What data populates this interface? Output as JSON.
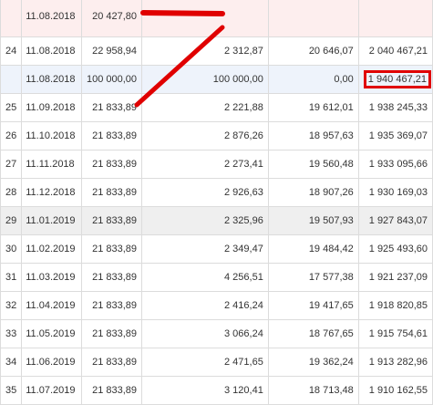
{
  "schedule": {
    "rows": [
      {
        "num": "",
        "date": "11.08.2018",
        "payment": "20 427,80",
        "principal": "",
        "interest": "",
        "balance": "",
        "style": "pink"
      },
      {
        "num": "24",
        "date": "11.08.2018",
        "payment": "22 958,94",
        "principal": "2 312,87",
        "interest": "20 646,07",
        "balance": "2 040 467,21",
        "style": ""
      },
      {
        "num": "",
        "date": "11.08.2018",
        "payment": "100 000,00",
        "principal": "100 000,00",
        "interest": "0,00",
        "balance": "1 940 467,21",
        "style": "blue",
        "highlight": true
      },
      {
        "num": "25",
        "date": "11.09.2018",
        "payment": "21 833,89",
        "principal": "2 221,88",
        "interest": "19 612,01",
        "balance": "1 938 245,33",
        "style": ""
      },
      {
        "num": "26",
        "date": "11.10.2018",
        "payment": "21 833,89",
        "principal": "2 876,26",
        "interest": "18 957,63",
        "balance": "1 935 369,07",
        "style": ""
      },
      {
        "num": "27",
        "date": "11.11.2018",
        "payment": "21 833,89",
        "principal": "2 273,41",
        "interest": "19 560,48",
        "balance": "1 933 095,66",
        "style": ""
      },
      {
        "num": "28",
        "date": "11.12.2018",
        "payment": "21 833,89",
        "principal": "2 926,63",
        "interest": "18 907,26",
        "balance": "1 930 169,03",
        "style": ""
      },
      {
        "num": "29",
        "date": "11.01.2019",
        "payment": "21 833,89",
        "principal": "2 325,96",
        "interest": "19 507,93",
        "balance": "1 927 843,07",
        "style": "gray"
      },
      {
        "num": "30",
        "date": "11.02.2019",
        "payment": "21 833,89",
        "principal": "2 349,47",
        "interest": "19 484,42",
        "balance": "1 925 493,60",
        "style": ""
      },
      {
        "num": "31",
        "date": "11.03.2019",
        "payment": "21 833,89",
        "principal": "4 256,51",
        "interest": "17 577,38",
        "balance": "1 921 237,09",
        "style": ""
      },
      {
        "num": "32",
        "date": "11.04.2019",
        "payment": "21 833,89",
        "principal": "2 416,24",
        "interest": "19 417,65",
        "balance": "1 918 820,85",
        "style": ""
      },
      {
        "num": "33",
        "date": "11.05.2019",
        "payment": "21 833,89",
        "principal": "3 066,24",
        "interest": "18 767,65",
        "balance": "1 915 754,61",
        "style": ""
      },
      {
        "num": "34",
        "date": "11.06.2019",
        "payment": "21 833,89",
        "principal": "2 471,65",
        "interest": "19 362,24",
        "balance": "1 913 282,96",
        "style": ""
      },
      {
        "num": "35",
        "date": "11.07.2019",
        "payment": "21 833,89",
        "principal": "3 120,41",
        "interest": "18 713,48",
        "balance": "1 910 162,55",
        "style": ""
      }
    ]
  },
  "colors": {
    "annotation_red": "#e00000",
    "pink_row": "#fdeeee",
    "blue_row": "#eef3fb",
    "gray_row": "#efefef",
    "grid_line": "#dcdcdc"
  }
}
